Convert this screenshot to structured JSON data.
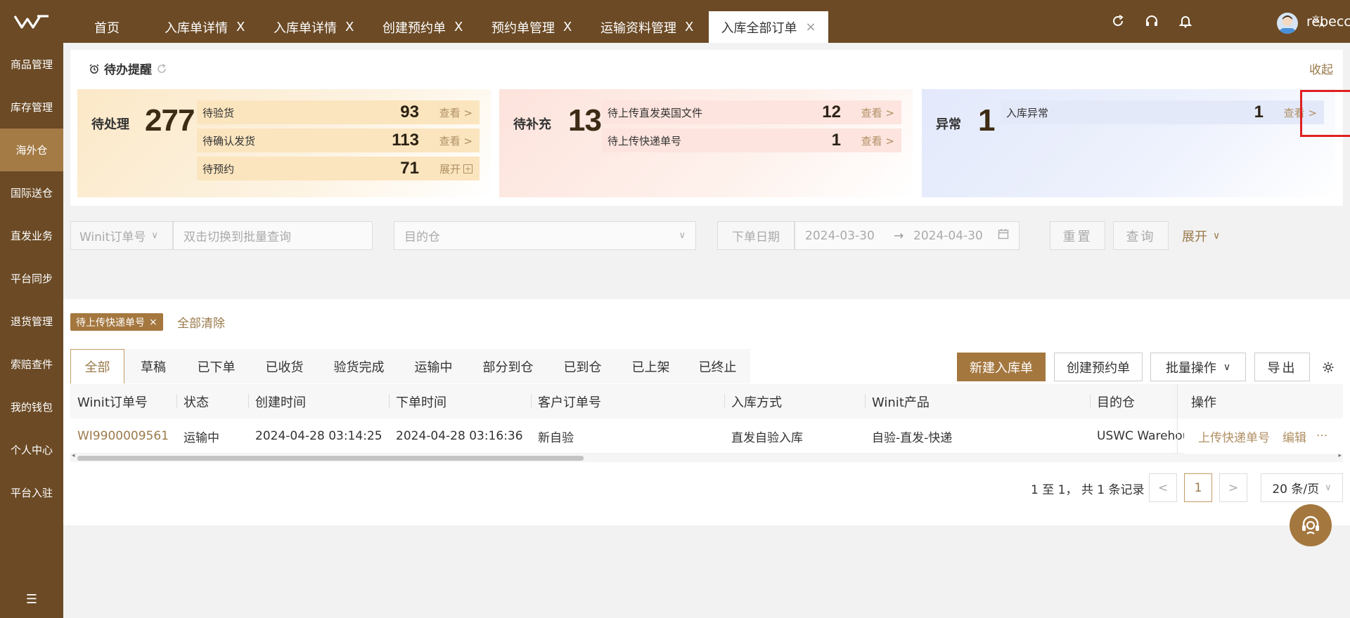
{
  "sidebar": {
    "items": [
      {
        "label": "商品管理"
      },
      {
        "label": "库存管理"
      },
      {
        "label": "海外仓"
      },
      {
        "label": "国际送仓"
      },
      {
        "label": "直发业务"
      },
      {
        "label": "平台同步"
      },
      {
        "label": "退货管理"
      },
      {
        "label": "索赔查件"
      },
      {
        "label": "我的钱包"
      },
      {
        "label": "个人中心"
      },
      {
        "label": "平台入驻"
      }
    ],
    "active_index": 2
  },
  "tabs": [
    {
      "label": "首页"
    },
    {
      "label": "入库单详情",
      "close": "X"
    },
    {
      "label": "入库单详情",
      "close": "X"
    },
    {
      "label": "创建预约单",
      "close": "X"
    },
    {
      "label": "预约单管理",
      "close": "X"
    },
    {
      "label": "运输资料管理",
      "close": "X"
    },
    {
      "label": "入库全部订单",
      "close": "×"
    }
  ],
  "user": {
    "name": "rebecca"
  },
  "header_icons": [
    "refresh-icon",
    "headset-icon",
    "bell-icon",
    "translate-icon"
  ],
  "todo": {
    "title": "待办提醒",
    "collapse": "收起",
    "cards": [
      {
        "label": "待处理",
        "total": "277",
        "rows": [
          {
            "label": "待验货",
            "count": "93",
            "link": "查看 >"
          },
          {
            "label": "待确认发货",
            "count": "113",
            "link": "查看 >"
          },
          {
            "label": "待预约",
            "count": "71",
            "link": "展开"
          }
        ]
      },
      {
        "label": "待补充",
        "total": "13",
        "rows": [
          {
            "label": "待上传直发英国文件",
            "count": "12",
            "link": "查看 >"
          },
          {
            "label": "待上传快递单号",
            "count": "1",
            "link": "查看 >"
          }
        ]
      },
      {
        "label": "异常",
        "total": "1",
        "rows": [
          {
            "label": "入库异常",
            "count": "1",
            "link": "查看 >"
          }
        ]
      }
    ]
  },
  "filters": {
    "order_type": "Winit订单号",
    "batch_placeholder": "双击切换到批量查询",
    "warehouse_placeholder": "目的仓",
    "date_label": "下单日期",
    "date_start": "2024-03-30",
    "date_arrow": "→",
    "date_end": "2024-04-30",
    "reset": "重置",
    "query": "查询",
    "expand": "展开"
  },
  "chips": {
    "active": "待上传快递单号",
    "clear_all": "全部清除"
  },
  "status_tabs": [
    "全部",
    "草稿",
    "已下单",
    "已收货",
    "验货完成",
    "运输中",
    "部分到仓",
    "已到仓",
    "已上架",
    "已终止"
  ],
  "actions": {
    "new_inbound": "新建入库单",
    "create_appointment": "创建预约单",
    "batch_ops": "批量操作",
    "export": "导出"
  },
  "table": {
    "columns": [
      "Winit订单号",
      "状态",
      "创建时间",
      "下单时间",
      "客户订单号",
      "入库方式",
      "Winit产品",
      "目的仓",
      "操作"
    ],
    "rows": [
      {
        "order_no": "WI9900009561",
        "status": "运输中",
        "created": "2024-04-28 03:14:25",
        "ordered": "2024-04-28 03:16:36",
        "customer_no": "新自验",
        "method": "直发自验入库",
        "product": "自验-直发-快递",
        "warehouse": "USWC Warehouse",
        "op_upload": "上传快递单号",
        "op_edit": "编辑",
        "op_more": "···"
      }
    ]
  },
  "pagination": {
    "summary": "1 至 1， 共 1 条记录",
    "prev": "<",
    "current": "1",
    "next": ">",
    "page_size": "20 条/页"
  },
  "colors": {
    "brand_dark": "#6b4a25",
    "brand_accent": "#a4773f",
    "highlight": "#e02020"
  }
}
